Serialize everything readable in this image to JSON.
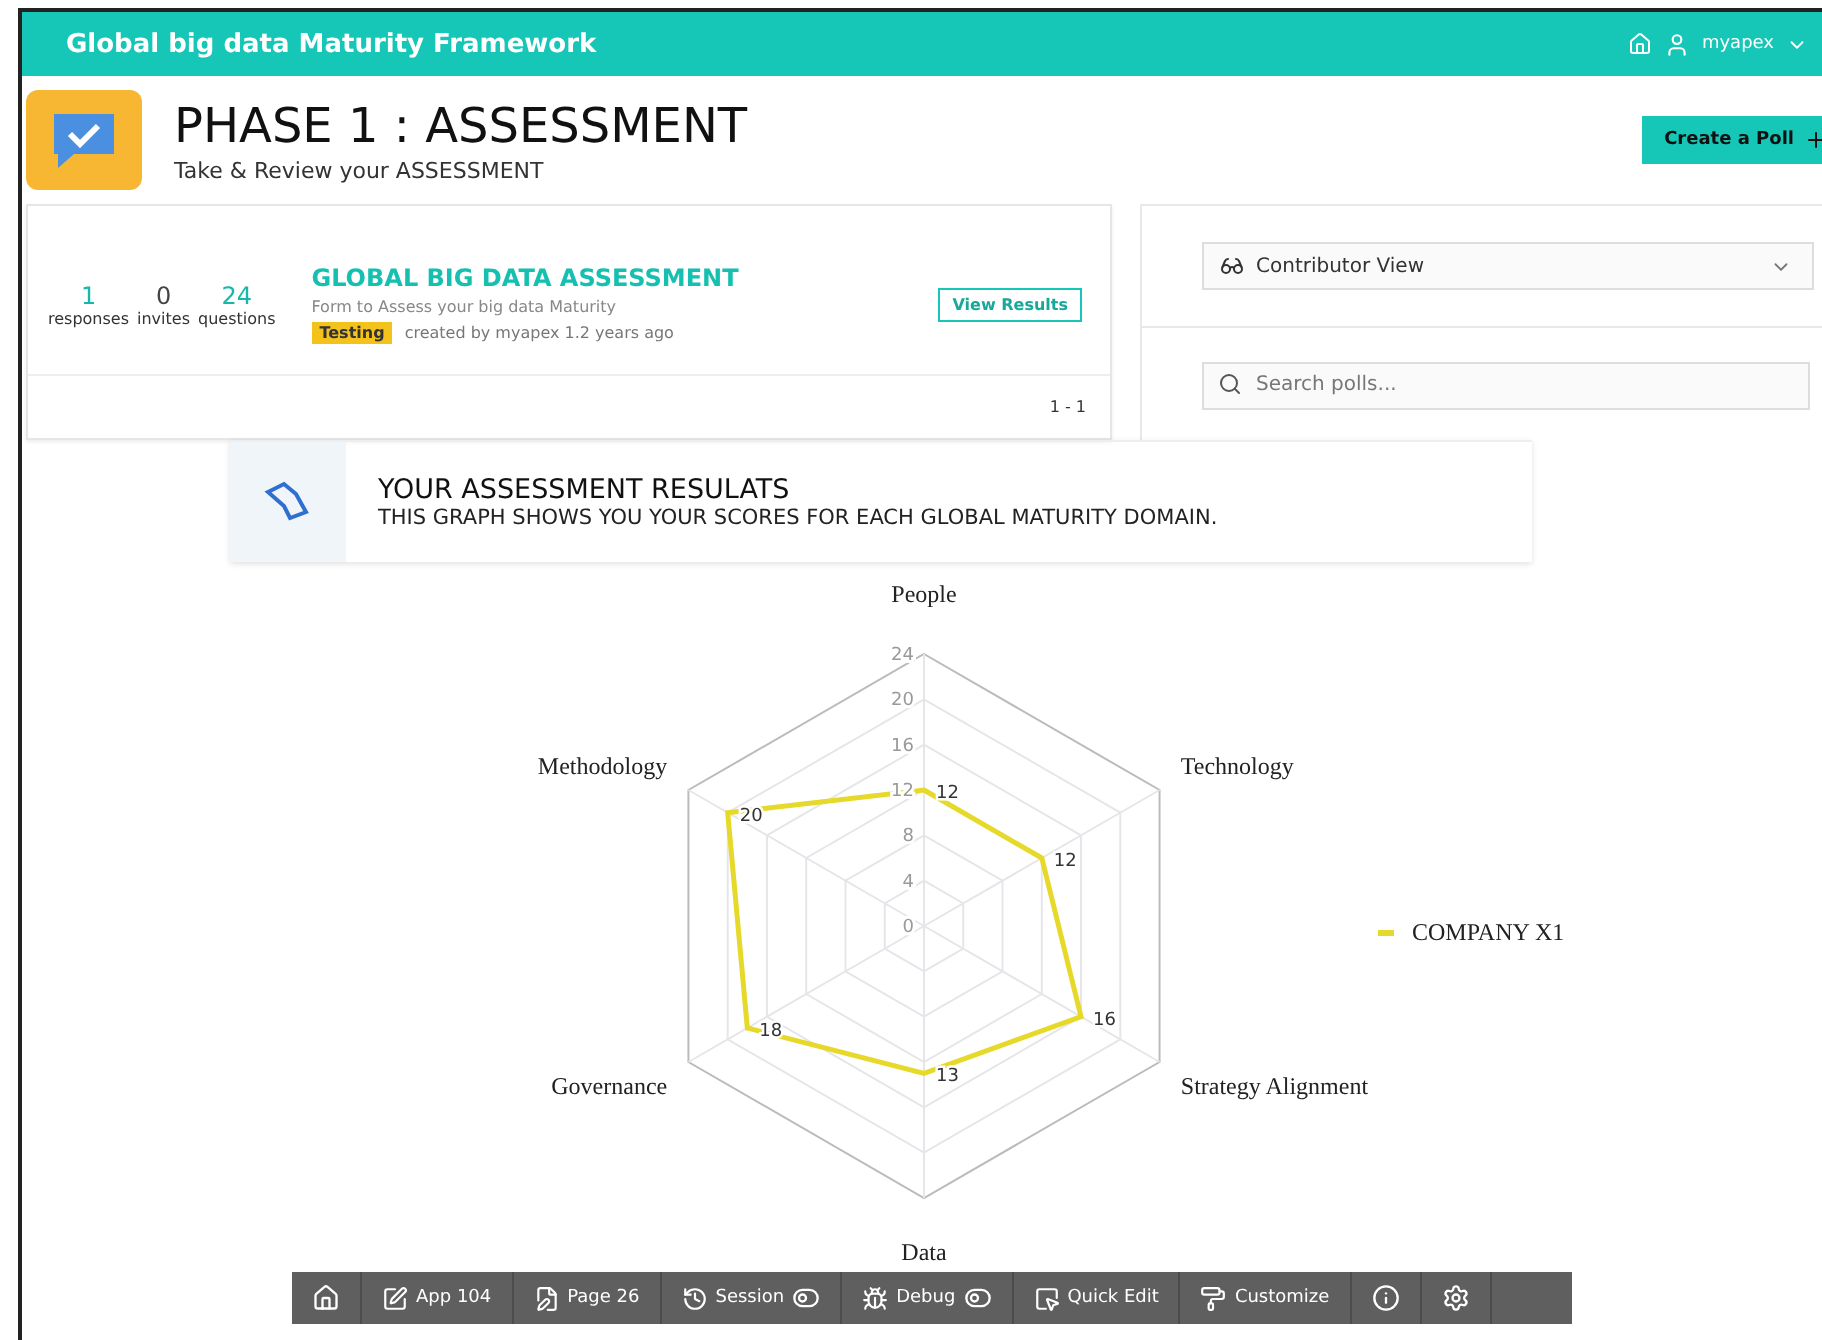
{
  "header": {
    "title": "Global big data Maturity Framework",
    "user": "myapex"
  },
  "page": {
    "title": "PHASE 1 : ASSESSMENT",
    "subtitle": "Take & Review your ASSESSMENT",
    "create_button": "Create a Poll"
  },
  "poll": {
    "stats": [
      {
        "value": "1",
        "label": "responses",
        "highlight": true
      },
      {
        "value": "0",
        "label": "invites",
        "highlight": false
      },
      {
        "value": "24",
        "label": "questions",
        "highlight": true
      }
    ],
    "title": "GLOBAL BIG DATA ASSESSMENT",
    "description": "Form to Assess your big data Maturity",
    "tag": "Testing",
    "meta": "created by myapex 1.2 years ago",
    "button": "View Results",
    "pagination": "1 - 1"
  },
  "sidebar": {
    "view_select": "Contributor View",
    "search": {
      "placeholder": "Search polls..."
    }
  },
  "results": {
    "title": "YOUR ASSESSMENT RESULATS",
    "subtitle": "THIS GRAPH SHOWS YOU YOUR SCORES FOR EACH GLOBAL MATURITY DOMAIN.",
    "radar": {
      "ticks": [
        "24",
        "20",
        "16",
        "12",
        "8",
        "4",
        "0"
      ],
      "axes": [
        {
          "label": "People",
          "score": "12"
        },
        {
          "label": "Methodology",
          "score": "20"
        },
        {
          "label": "Technology",
          "score": "12"
        },
        {
          "label": "Governance",
          "score": "18"
        },
        {
          "label": "Strategy Alignment",
          "score": "16"
        },
        {
          "label": "Data",
          "score": "13"
        }
      ],
      "legend": {
        "name": "COMPANY X1",
        "color": "#e6d92a"
      }
    }
  },
  "dev_toolbar": [
    {
      "label": "App 104"
    },
    {
      "label": "Page 26"
    },
    {
      "label": "Session"
    },
    {
      "label": "Debug"
    },
    {
      "label": "Quick Edit"
    },
    {
      "label": "Customize"
    }
  ]
}
